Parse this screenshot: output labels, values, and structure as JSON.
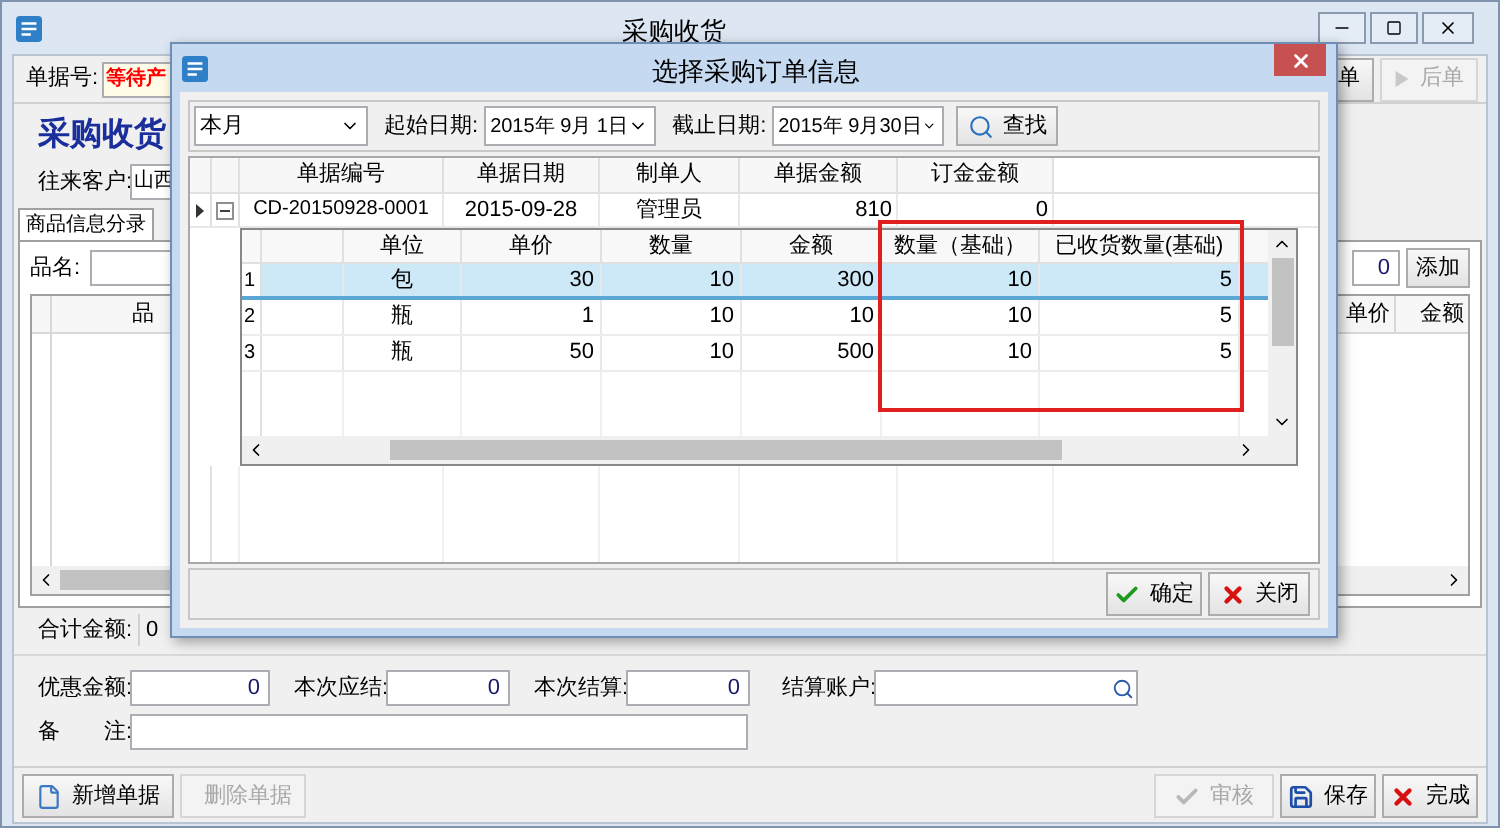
{
  "window": {
    "title": "采购收货"
  },
  "bill": {
    "label": "单据号:",
    "value": "等待产"
  },
  "nav_buttons": [
    {
      "label": "单",
      "kind": "prev",
      "disabled": false
    },
    {
      "label": "后单",
      "kind": "next",
      "disabled": true
    }
  ],
  "heading": "采购收货",
  "customer": {
    "label": "往来客户:",
    "value": "山西"
  },
  "tabs": [
    {
      "label": "商品信息分录",
      "selected": true
    }
  ],
  "product_filter": {
    "label": "品名:",
    "quantity": "0",
    "add_button": "添加"
  },
  "goods_table": {
    "left_columns": [
      "品"
    ],
    "right_columns": [
      "单价",
      "金额"
    ]
  },
  "total": {
    "label": "合计金额:",
    "value": "0"
  },
  "amount_fields": [
    {
      "label": "优惠金额:",
      "value": "0"
    },
    {
      "label": "本次应结:",
      "value": "0"
    },
    {
      "label": "本次结算:",
      "value": "0"
    }
  ],
  "account": {
    "label": "结算账户:"
  },
  "remark": {
    "label": "备　　注:"
  },
  "left_buttons": [
    {
      "label": "新增单据",
      "kind": "new",
      "disabled": false
    },
    {
      "label": "删除单据",
      "kind": "plain",
      "disabled": true
    }
  ],
  "right_buttons": [
    {
      "label": "审核",
      "kind": "check",
      "disabled": true
    },
    {
      "label": "保存",
      "kind": "save",
      "disabled": false
    },
    {
      "label": "完成",
      "kind": "close",
      "disabled": false
    }
  ],
  "dialog": {
    "title": "选择采购订单信息",
    "period": "本月",
    "start_label": "起始日期:",
    "start_date": "2015年 9月 1日",
    "end_label": "截止日期:",
    "end_date": "2015年 9月30日",
    "search_button": "查找",
    "orders": {
      "columns": [
        "单据编号",
        "单据日期",
        "制单人",
        "单据金额",
        "订金金额"
      ],
      "rows": [
        {
          "cells": [
            "CD-20150928-0001",
            "2015-09-28",
            "管理员",
            "810",
            "0"
          ],
          "selected": true,
          "expanded": true
        }
      ]
    },
    "details": {
      "columns": [
        "单位",
        "单价",
        "数量",
        "金额",
        "数量（基础）",
        "已收货数量(基础)"
      ],
      "rows": [
        {
          "number": "1",
          "cells": [
            "包",
            "30",
            "10",
            "300",
            "10",
            "5"
          ],
          "selected": true
        },
        {
          "number": "2",
          "cells": [
            "瓶",
            "1",
            "10",
            "10",
            "10",
            "5"
          ],
          "selected": false
        },
        {
          "number": "3",
          "cells": [
            "瓶",
            "50",
            "10",
            "500",
            "10",
            "5"
          ],
          "selected": false
        }
      ]
    },
    "buttons": [
      {
        "label": "确定",
        "kind": "ok",
        "disabled": false
      },
      {
        "label": "关闭",
        "kind": "close",
        "disabled": false
      }
    ]
  }
}
